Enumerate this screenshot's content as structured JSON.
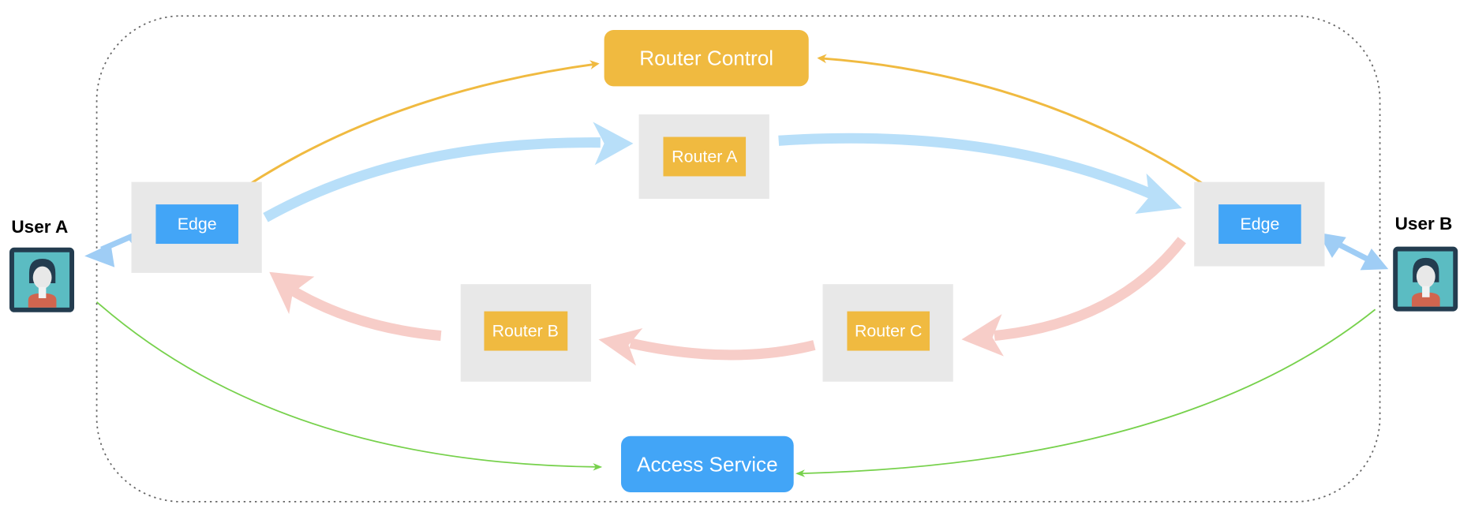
{
  "nodes": {
    "router_control": "Router Control",
    "router_a": "Router A",
    "router_b": "Router B",
    "router_c": "Router C",
    "edge_left": "Edge",
    "edge_right": "Edge",
    "access_service": "Access Service",
    "user_a": "User A",
    "user_b": "User B"
  },
  "colors": {
    "router": "#F0BA40",
    "edge": "#42A5F7",
    "container": "#E8E8E8",
    "forward_flow": "#B8DFF9",
    "return_flow": "#F7CDC8",
    "control": "#F0BA40",
    "access": "#77D14C"
  }
}
